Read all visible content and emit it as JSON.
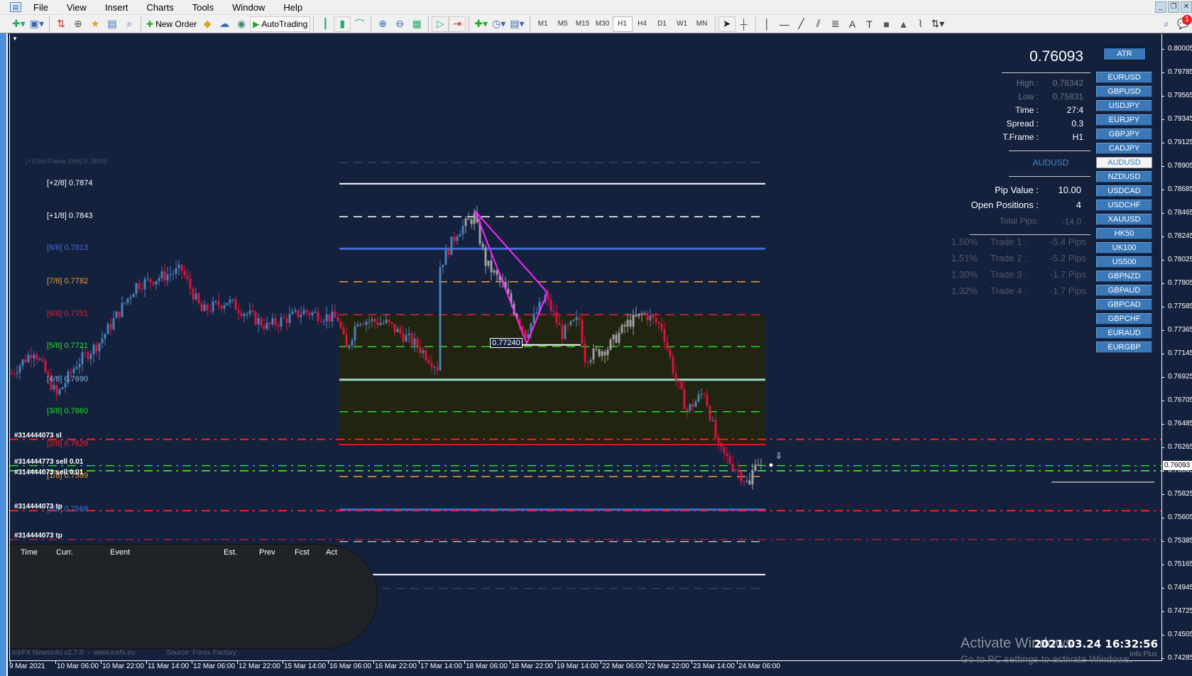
{
  "menu": {
    "items": [
      "File",
      "View",
      "Insert",
      "Charts",
      "Tools",
      "Window",
      "Help"
    ]
  },
  "toolbar": {
    "new_order_label": "New Order",
    "autotrading_label": "AutoTrading",
    "timeframes": [
      "M1",
      "M5",
      "M15",
      "M30",
      "H1",
      "H4",
      "D1",
      "W1",
      "MN"
    ],
    "active_timeframe": "H1",
    "notification_count": "1"
  },
  "info_panel": {
    "price": "0.76093",
    "atr_label": "ATR",
    "rows": [
      {
        "label": "High :",
        "value": "0.76342",
        "dim": true
      },
      {
        "label": "Low :",
        "value": "0.75831",
        "dim": true
      },
      {
        "label": "Time :",
        "value": "27:4",
        "dim": false
      },
      {
        "label": "Spread :",
        "value": "0.3",
        "dim": false
      },
      {
        "label": "T.Frame :",
        "value": "H1",
        "dim": false
      }
    ],
    "symbol": "AUDUSD",
    "pip_value_label": "Pip Value :",
    "pip_value": "10.00",
    "open_positions_label": "Open Positions :",
    "open_positions": "4",
    "total_pips_label": "Total Pips:",
    "total_pips": "-14.0",
    "trades": [
      {
        "pct": "1.50%",
        "label": "Trade 1 :",
        "pips": "-5.4 Pips"
      },
      {
        "pct": "1.51%",
        "label": "Trade 2 :",
        "pips": "-5.2 Pips"
      },
      {
        "pct": "1.30%",
        "label": "Trade 3 :",
        "pips": "-1.7 Pips"
      },
      {
        "pct": "1.32%",
        "label": "Trade 4 :",
        "pips": "-1.7 Pips"
      }
    ],
    "symbols": [
      "EURUSD",
      "GBPUSD",
      "USDJPY",
      "EURJPY",
      "GBPJPY",
      "CADJPY",
      "AUDUSD",
      "NZDUSD",
      "USDCAD",
      "USDCHF",
      "XAUUSD",
      "HK50",
      "UK100",
      "US500",
      "GBPNZD",
      "GBPAUD",
      "GBPCAD",
      "GBPCHF",
      "EURAUD",
      "EURGBP"
    ],
    "selected_symbol": "AUDUSD"
  },
  "murrey_levels": [
    {
      "tag": "[+1/3rd Frame Shift]",
      "value": "0.78939",
      "price": 0.78939,
      "color": "#4a5568",
      "style": "dash",
      "w": 1
    },
    {
      "tag": "[+2/8]",
      "value": "0.7874",
      "price": 0.7874,
      "color": "#ffffff",
      "style": "solid",
      "w": 2
    },
    {
      "tag": "[+1/8]",
      "value": "0.7843",
      "price": 0.7843,
      "color": "#ffffff",
      "style": "dash",
      "w": 1.5
    },
    {
      "tag": "[8/8]",
      "value": "0.7813",
      "price": 0.7813,
      "color": "#3f6fd8",
      "style": "solid",
      "w": 3
    },
    {
      "tag": "[7/8]",
      "value": "0.7782",
      "price": 0.7782,
      "color": "#e8a030",
      "style": "dash",
      "w": 1.5
    },
    {
      "tag": "[6/8]",
      "value": "0.7751",
      "price": 0.7751,
      "color": "#e0203a",
      "style": "dash",
      "w": 1.5
    },
    {
      "tag": "[5/8]",
      "value": "0.7721",
      "price": 0.7721,
      "color": "#22e022",
      "style": "dash",
      "w": 1.5
    },
    {
      "tag": "[4/8]",
      "value": "0.7690",
      "price": 0.769,
      "color": "#9ad8d0",
      "style": "solid",
      "w": 3,
      "label_color": "#8ab8e8"
    },
    {
      "tag": "[3/8]",
      "value": "0.7660",
      "price": 0.766,
      "color": "#22e022",
      "style": "dash",
      "w": 1.5
    },
    {
      "tag": "[2/8]",
      "value": "0.7629",
      "price": 0.7629,
      "color": "#ff2020",
      "style": "solid",
      "w": 1.5
    },
    {
      "tag": "[1/8]",
      "value": "0.7599",
      "price": 0.7599,
      "color": "#e8a030",
      "style": "dash",
      "w": 1.5
    },
    {
      "tag": "[0/8]",
      "value": "0.7568",
      "price": 0.7568,
      "color": "#3f6fd8",
      "style": "solid",
      "w": 3
    },
    {
      "tag": "",
      "value": "",
      "price": 0.7538,
      "color": "#ffffff",
      "style": "dash",
      "w": 1
    },
    {
      "tag": "",
      "value": "",
      "price": 0.7507,
      "color": "#ffffff",
      "style": "solid",
      "w": 2
    },
    {
      "tag": "",
      "value": "",
      "price": 0.7494,
      "color": "#4a5568",
      "style": "dash",
      "w": 1
    }
  ],
  "trade_lines": [
    {
      "text": "#314444073 sl",
      "price": 0.7634,
      "color": "#ff1a1a",
      "w": 2
    },
    {
      "text": "#314444773 sell 0.01",
      "price": 0.76093,
      "color": "#33cc33",
      "w": 1.5
    },
    {
      "text": "#314444073 sell 0.01",
      "price": 0.76045,
      "color": "#33cc33",
      "w": 2
    },
    {
      "text": "#314444073 tp",
      "price": 0.7567,
      "color": "#ff1a1a",
      "w": 2
    },
    {
      "text": "#314444073 tp",
      "price": 0.754,
      "color": "#ff1a1a",
      "w": 1
    }
  ],
  "chart_data": {
    "type": "candlestick",
    "symbol": "AUDUSD",
    "timeframe": "H1",
    "ylim": [
      0.7418,
      0.8005
    ],
    "price_ticks": [
      "0.80005",
      "0.79785",
      "0.79565",
      "0.79345",
      "0.79125",
      "0.78905",
      "0.78685",
      "0.78465",
      "0.78245",
      "0.78025",
      "0.77805",
      "0.77585",
      "0.77365",
      "0.77145",
      "0.76925",
      "0.76705",
      "0.76485",
      "0.76265",
      "0.76045",
      "0.75825",
      "0.75605",
      "0.75385",
      "0.75165",
      "0.74945",
      "0.74725",
      "0.74505",
      "0.74285"
    ],
    "current_price": "0.76093",
    "time_ticks": [
      "9 Mar 2021",
      "10 Mar 06:00",
      "10 Mar 22:00",
      "11 Mar 14:00",
      "12 Mar 06:00",
      "12 Mar 22:00",
      "15 Mar 14:00",
      "16 Mar 06:00",
      "16 Mar 22:00",
      "17 Mar 14:00",
      "18 Mar 06:00",
      "18 Mar 22:00",
      "19 Mar 14:00",
      "22 Mar 06:00",
      "22 Mar 22:00",
      "23 Mar 14:00",
      "24 Mar 06:00"
    ],
    "close_anchors_by_bar": [
      [
        0,
        0.7696
      ],
      [
        8,
        0.7718
      ],
      [
        16,
        0.7675
      ],
      [
        23,
        0.7705
      ],
      [
        31,
        0.7725
      ],
      [
        44,
        0.7779
      ],
      [
        60,
        0.7793
      ],
      [
        67,
        0.7754
      ],
      [
        76,
        0.7764
      ],
      [
        90,
        0.774
      ],
      [
        103,
        0.7754
      ],
      [
        115,
        0.7747
      ],
      [
        118,
        0.7718
      ],
      [
        122,
        0.7747
      ],
      [
        132,
        0.7743
      ],
      [
        143,
        0.7722
      ],
      [
        150,
        0.7702
      ],
      [
        151,
        0.7797
      ],
      [
        157,
        0.7829
      ],
      [
        163,
        0.7843
      ],
      [
        167,
        0.78
      ],
      [
        173,
        0.7779
      ],
      [
        181,
        0.7733
      ],
      [
        188,
        0.7768
      ],
      [
        194,
        0.7733
      ],
      [
        200,
        0.7747
      ],
      [
        202,
        0.7711
      ],
      [
        210,
        0.772
      ],
      [
        217,
        0.7743
      ],
      [
        223,
        0.7752
      ],
      [
        229,
        0.774
      ],
      [
        234,
        0.769
      ],
      [
        238,
        0.7661
      ],
      [
        244,
        0.7679
      ],
      [
        249,
        0.7625
      ],
      [
        256,
        0.7604
      ],
      [
        260,
        0.759
      ],
      [
        262,
        0.7616
      ],
      [
        264,
        0.761
      ]
    ],
    "pattern_label": "0.77240",
    "pattern_price": 0.7724,
    "colors": {
      "bull": "#4a80b8",
      "bear": "#dc143c",
      "neutral": "#a0a0a0",
      "pattern": "#ff22ff",
      "zone": "#202410"
    }
  },
  "news": {
    "headers": [
      "Time",
      "Curr.",
      "Event",
      "Est.",
      "Prev",
      "Fcst",
      "Act"
    ],
    "footer_left": "IceFX NewsInfo v2.7.0  -  www.icefx.eu",
    "footer_right": "Source: Forex Factory"
  },
  "clock": {
    "datetime": "2021.03.24 16:32:56",
    "caption": "Info Plus"
  },
  "watermark": {
    "line1": "Activate Windows",
    "line2": "Go to PC settings to activate Windows."
  }
}
